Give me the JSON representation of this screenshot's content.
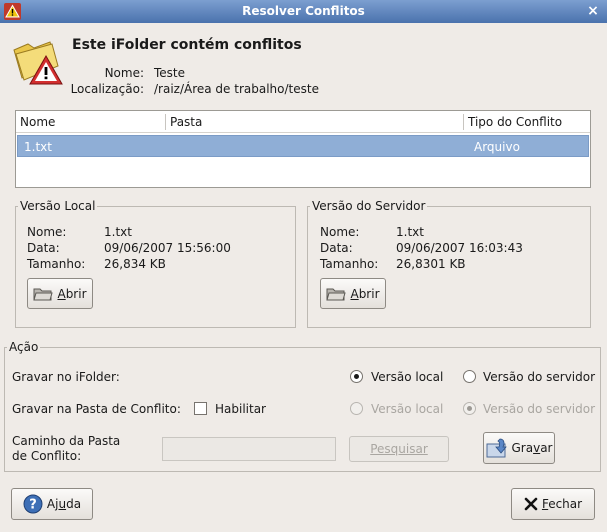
{
  "window": {
    "title": "Resolver Conflitos",
    "close_glyph": "×"
  },
  "header": {
    "title": "Este iFolder contém conflitos",
    "name_label": "Nome:",
    "name_value": "Teste",
    "location_label": "Localização:",
    "location_value": "/raiz/Área de trabalho/teste"
  },
  "table": {
    "columns": [
      "Nome",
      "Pasta",
      "Tipo do Conflito"
    ],
    "rows": [
      {
        "name": "1.txt",
        "folder": "",
        "type": "Arquivo"
      }
    ],
    "selected_color": "#8faed6"
  },
  "local": {
    "legend": "Versão Local",
    "name_label": "Nome:",
    "name_value": "1.txt",
    "date_label": "Data:",
    "date_value": "09/06/2007 15:56:00",
    "size_label": "Tamanho:",
    "size_value": "26,834 KB",
    "open_button": {
      "prefix": "",
      "mnemonic": "A",
      "rest": "brir"
    }
  },
  "server": {
    "legend": "Versão do Servidor",
    "name_label": "Nome:",
    "name_value": "1.txt",
    "date_label": "Data:",
    "date_value": "09/06/2007 16:03:43",
    "size_label": "Tamanho:",
    "size_value": "26,8301 KB",
    "open_button": {
      "prefix": "",
      "mnemonic": "A",
      "rest": "brir"
    }
  },
  "action": {
    "legend": "Ação",
    "save_ifolder_label": "Gravar no iFolder:",
    "local_version_label": "Versão local",
    "server_version_label": "Versão do servidor",
    "save_conflict_folder_label": "Gravar na Pasta de Conflito:",
    "enable_label": "Habilitar",
    "conflict_local_label": "Versão local",
    "conflict_server_label": "Versão do servidor",
    "path_label_line1": "Caminho da Pasta",
    "path_label_line2": "de Conflito:",
    "path_value": "",
    "search_button": "Pesquisar",
    "save_button": {
      "prefix": "Gra",
      "mnemonic": "v",
      "rest": "ar"
    }
  },
  "footer": {
    "help_button": {
      "prefix": "Aj",
      "mnemonic": "u",
      "rest": "da"
    },
    "close_button": {
      "prefix": "",
      "mnemonic": "F",
      "rest": "echar"
    }
  }
}
